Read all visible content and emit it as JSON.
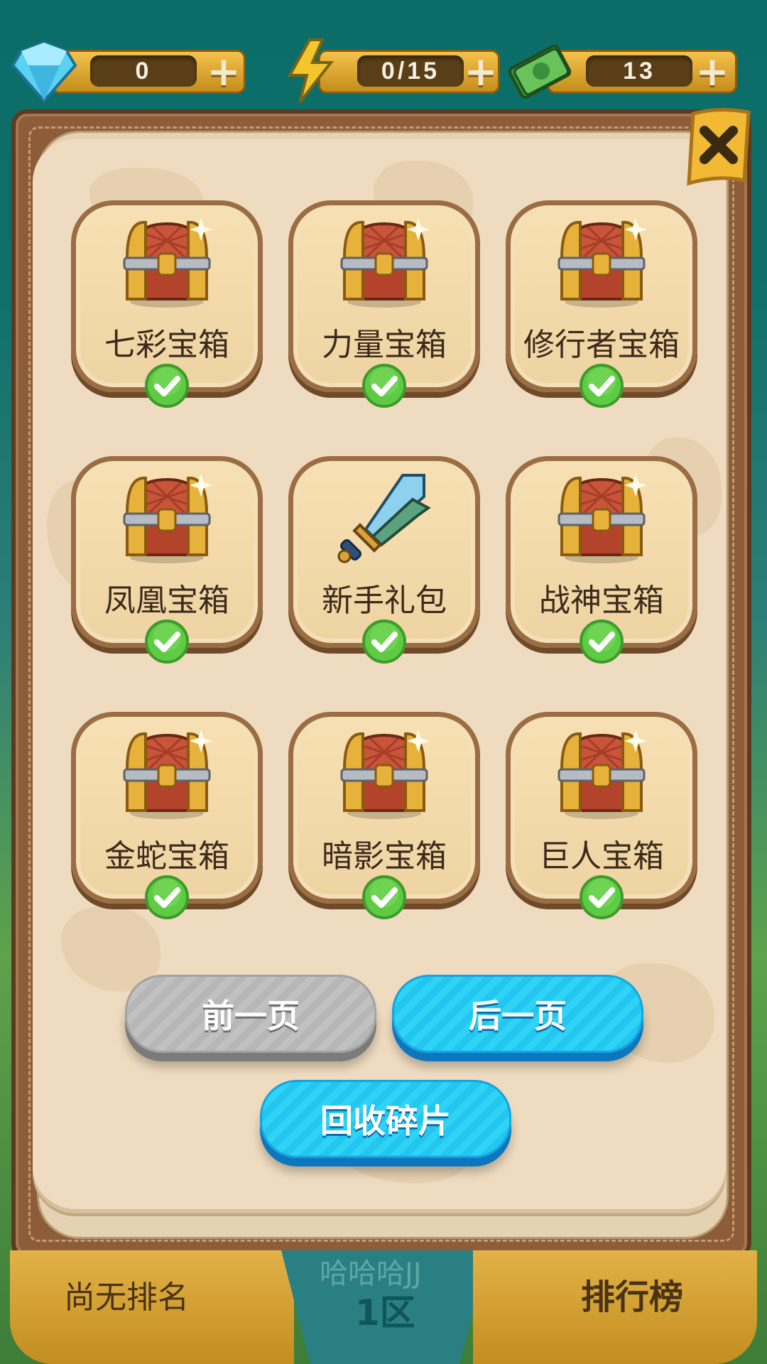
{
  "resources": [
    {
      "name": "diamond-icon",
      "value": "0"
    },
    {
      "name": "energy-icon",
      "value": "0/15"
    },
    {
      "name": "cash-icon",
      "value": "13"
    }
  ],
  "plus_glyph": "+",
  "close_glyph": "✕",
  "items": [
    {
      "label": "七彩宝箱",
      "icon": "treasure-chest-icon",
      "claimed": true
    },
    {
      "label": "力量宝箱",
      "icon": "treasure-chest-icon",
      "claimed": true
    },
    {
      "label": "修行者宝箱",
      "icon": "treasure-chest-icon",
      "claimed": true
    },
    {
      "label": "凤凰宝箱",
      "icon": "treasure-chest-icon",
      "claimed": true
    },
    {
      "label": "新手礼包",
      "icon": "swords-icon",
      "claimed": true
    },
    {
      "label": "战神宝箱",
      "icon": "treasure-chest-icon",
      "claimed": true
    },
    {
      "label": "金蛇宝箱",
      "icon": "treasure-chest-icon",
      "claimed": true
    },
    {
      "label": "暗影宝箱",
      "icon": "treasure-chest-icon",
      "claimed": true
    },
    {
      "label": "巨人宝箱",
      "icon": "treasure-chest-icon",
      "claimed": true
    }
  ],
  "buttons": {
    "prev": "前一页",
    "next": "后一页",
    "recycle": "回收碎片"
  },
  "bottom": {
    "rank": "尚无排名",
    "server_name": "哈哈哈JJ",
    "server_zone": "1区",
    "leaderboard": "排行榜"
  },
  "colors": {
    "accent_blue": "#22c6ef",
    "disabled_gray": "#b7b7b7",
    "panel_wood": "#8c5d38",
    "page_paper": "#efdcc0",
    "check_green": "#5fcb45"
  }
}
